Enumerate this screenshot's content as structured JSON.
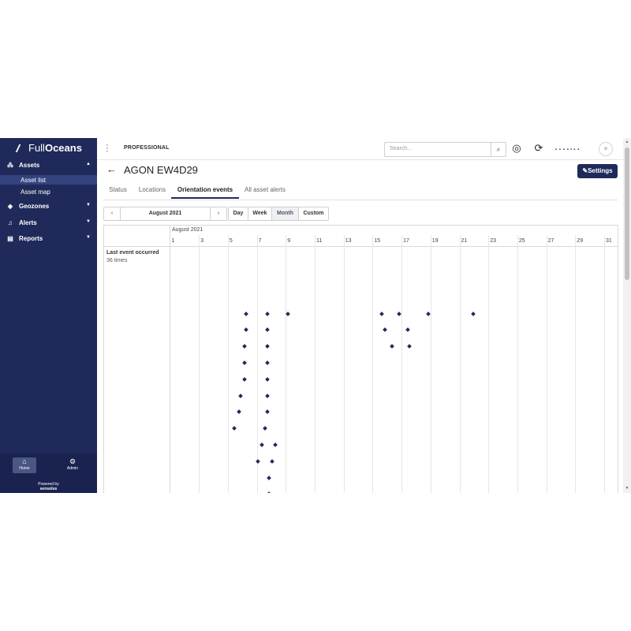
{
  "app": {
    "brand": {
      "part1": "Full",
      "part2": "Oceans"
    },
    "plan": "PROFESSIONAL"
  },
  "sidebar": {
    "items": [
      {
        "label": "Assets",
        "icon": "assets-icon",
        "expanded": true,
        "children": [
          {
            "label": "Asset list",
            "active": true
          },
          {
            "label": "Asset map",
            "active": false
          }
        ]
      },
      {
        "label": "Geozones",
        "icon": "geozone-icon"
      },
      {
        "label": "Alerts",
        "icon": "bell-icon"
      },
      {
        "label": "Reports",
        "icon": "report-icon"
      }
    ],
    "footer": {
      "home_label": "Home",
      "admin_label": "Admin",
      "powered_by": "Powered by",
      "powered_brand": "sensolus"
    }
  },
  "topbar": {
    "search_placeholder": "Search..."
  },
  "asset": {
    "title": "AGON EW4D29",
    "settings_label": "Settings"
  },
  "tabs": [
    {
      "label": "Status",
      "active": false
    },
    {
      "label": "Locations",
      "active": false
    },
    {
      "label": "Orientation events",
      "active": true
    },
    {
      "label": "All asset alerts",
      "active": false
    }
  ],
  "date_nav": {
    "current": "August 2021",
    "prev_label": "‹",
    "next_label": "›"
  },
  "range_buttons": [
    {
      "label": "Day",
      "selected": false
    },
    {
      "label": "Week",
      "selected": false
    },
    {
      "label": "Month",
      "selected": true
    },
    {
      "label": "Custom",
      "selected": false
    }
  ],
  "timeline": {
    "month_label": "August 2021",
    "ticks": [
      "1",
      "3",
      "5",
      "7",
      "9",
      "11",
      "13",
      "15",
      "17",
      "19",
      "21",
      "23",
      "25",
      "27",
      "29",
      "31"
    ],
    "row_label": "Last event occurred",
    "row_count": "36 times"
  },
  "chart_data": {
    "type": "scatter",
    "x_unit": "day of August 2021",
    "xlim": [
      1,
      31
    ],
    "series": [
      {
        "values": [
          {
            "day": 6.2
          },
          {
            "day": 7.7
          },
          {
            "day": 9.1
          },
          {
            "day": 15.6
          },
          {
            "day": 16.8
          },
          {
            "day": 18.8
          },
          {
            "day": 21.9
          },
          {
            "day": 6.2
          },
          {
            "day": 7.7
          },
          {
            "day": 15.8
          },
          {
            "day": 17.4
          },
          {
            "day": 6.1
          },
          {
            "day": 7.7
          },
          {
            "day": 16.3
          },
          {
            "day": 17.5
          },
          {
            "day": 6.1
          },
          {
            "day": 7.7
          },
          {
            "day": 6.1
          },
          {
            "day": 7.7
          },
          {
            "day": 5.8
          },
          {
            "day": 7.7
          },
          {
            "day": 5.7
          },
          {
            "day": 7.7
          },
          {
            "day": 5.4
          },
          {
            "day": 7.5
          },
          {
            "day": 7.3
          },
          {
            "day": 8.2
          },
          {
            "day": 7.0
          },
          {
            "day": 8.0
          },
          {
            "day": 7.8
          },
          {
            "day": 7.8
          },
          {
            "day": 7.8
          },
          {
            "day": 7.9
          },
          {
            "day": 7.9
          }
        ]
      }
    ]
  },
  "colors": {
    "sidebar": "#1f2a5a",
    "accent": "#1f2a5a",
    "active_nav": "#34437f",
    "marker": "#1f2a5a"
  }
}
